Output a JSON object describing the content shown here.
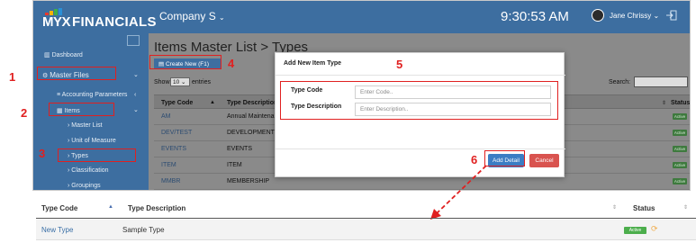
{
  "app": {
    "logo_prefix": "MYX",
    "logo_suffix": "FINANCIALS",
    "company": "Company S",
    "clock": "9:30:53 AM",
    "user_name": "Jane Chrissy",
    "brand_color": "#3d6ea0"
  },
  "sidebar": {
    "dashboard": "Dashboard",
    "master_files": "Master Files",
    "accounting_parameters": "Accounting Parameters",
    "items": "Items",
    "master_list": "Master List",
    "unit_of_measure": "Unit of Measure",
    "types": "Types",
    "classification": "Classification",
    "groupings": "Groupings"
  },
  "main": {
    "title": "Items Master List > Types",
    "create_button": "Create New (F1)",
    "show_label": "Show",
    "show_value": "10",
    "entries_label": "entries",
    "search_label": "Search:",
    "columns": [
      "Type Code",
      "Type Description",
      "Status"
    ],
    "rows": [
      {
        "code": "AM",
        "description": "Annual Maintenance",
        "status": "Active"
      },
      {
        "code": "DEV/TEST",
        "description": "DEVELOPMENT AND",
        "status": "Active"
      },
      {
        "code": "EVENTS",
        "description": "EVENTS",
        "status": "Active"
      },
      {
        "code": "ITEM",
        "description": "ITEM",
        "status": "Active"
      },
      {
        "code": "MMBR",
        "description": "MEMBERSHIP",
        "status": "Active"
      }
    ]
  },
  "modal": {
    "title": "Add New Item Type",
    "type_code_label": "Type Code",
    "type_code_placeholder": "Enter Code..",
    "type_description_label": "Type Description",
    "type_description_placeholder": "Enter Description..",
    "add_button": "Add Detail",
    "cancel_button": "Cancel"
  },
  "annotations": [
    "1",
    "2",
    "3",
    "4",
    "5",
    "6"
  ],
  "result_table": {
    "columns": [
      "Type Code",
      "Type Description",
      "Status"
    ],
    "row": {
      "code": "New Type",
      "description": "Sample Type",
      "status": "Active"
    }
  }
}
